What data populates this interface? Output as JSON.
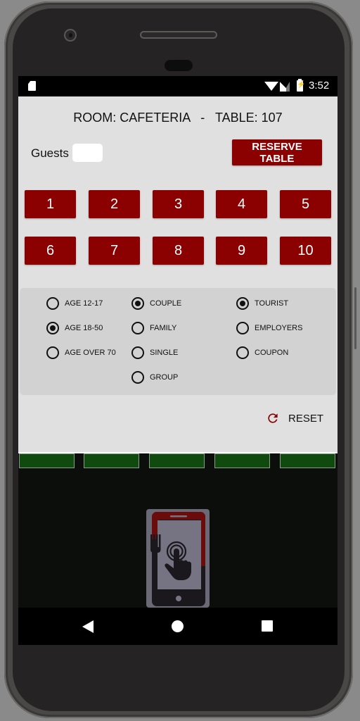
{
  "status_bar": {
    "time": "3:52",
    "icons": [
      "sd-card-icon",
      "wifi-icon",
      "signal-icon",
      "battery-charging-icon"
    ]
  },
  "header": {
    "title": "ROOM: CAFETERIA   -   TABLE: 107"
  },
  "guests": {
    "label": "Guests",
    "value": "",
    "placeholder": ""
  },
  "reserve_button": {
    "label": "RESERVE TABLE"
  },
  "number_buttons": [
    "1",
    "2",
    "3",
    "4",
    "5",
    "6",
    "7",
    "8",
    "9",
    "10"
  ],
  "options": {
    "age": [
      {
        "label": "AGE 12-17",
        "checked": false
      },
      {
        "label": "AGE 18-50",
        "checked": true
      },
      {
        "label": "AGE OVER 70",
        "checked": false
      }
    ],
    "group_type": [
      {
        "label": "COUPLE",
        "checked": true
      },
      {
        "label": "FAMILY",
        "checked": false
      },
      {
        "label": "SINGLE",
        "checked": false
      },
      {
        "label": "GROUP",
        "checked": false
      }
    ],
    "customer_type": [
      {
        "label": "TOURIST",
        "checked": true
      },
      {
        "label": "EMPLOYERS",
        "checked": false
      },
      {
        "label": "COUPON",
        "checked": false
      }
    ]
  },
  "reset": {
    "label": "RESET",
    "icon": "refresh-icon"
  },
  "colors": {
    "accent": "#8b0000",
    "panel_bg": "#e0e0e0",
    "options_bg": "#d2d2d2",
    "strip_green": "#114a0e"
  },
  "green_strip_count": 5,
  "logo": {
    "icon": "phone-touch-fork-logo"
  },
  "nav_bar": {
    "icons": [
      "back-icon",
      "home-icon",
      "recents-icon"
    ]
  }
}
